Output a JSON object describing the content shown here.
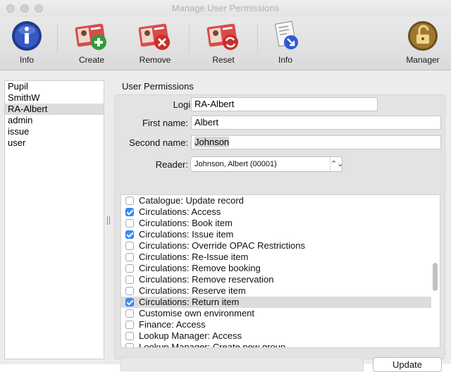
{
  "window": {
    "title": "Manage User Permissions"
  },
  "toolbar": {
    "items": [
      {
        "id": "info",
        "label": "Info",
        "icon": "info-circle-icon"
      },
      {
        "id": "create",
        "label": "Create",
        "icon": "user-card-add-icon"
      },
      {
        "id": "remove",
        "label": "Remove",
        "icon": "user-card-remove-icon"
      },
      {
        "id": "reset",
        "label": "Reset",
        "icon": "user-card-reset-icon"
      },
      {
        "id": "info2",
        "label": "Info",
        "icon": "document-arrow-icon"
      },
      {
        "id": "manager",
        "label": "Manager",
        "icon": "unlocked-padlock-icon"
      }
    ]
  },
  "users": [
    "Pupil",
    "SmithW",
    "RA-Albert",
    "admin",
    "issue",
    "user"
  ],
  "selected_user": "RA-Albert",
  "panel": {
    "title": "User Permissions",
    "login_label": "Login:",
    "login_value": "RA-Albert",
    "first_name_label": "First name:",
    "first_name_value": "Albert",
    "second_name_label": "Second name:",
    "second_name_value": "Johnson",
    "reader_label": "Reader:",
    "reader_value": "Johnson, Albert (00001)"
  },
  "permissions": [
    {
      "label": "Catalogue: Update record",
      "checked": false,
      "selected": false
    },
    {
      "label": "Circulations: Access",
      "checked": true,
      "selected": false
    },
    {
      "label": "Circulations: Book item",
      "checked": false,
      "selected": false
    },
    {
      "label": "Circulations: Issue item",
      "checked": true,
      "selected": false
    },
    {
      "label": "Circulations: Override OPAC Restrictions",
      "checked": false,
      "selected": false
    },
    {
      "label": "Circulations: Re-Issue item",
      "checked": false,
      "selected": false
    },
    {
      "label": "Circulations: Remove booking",
      "checked": false,
      "selected": false
    },
    {
      "label": "Circulations: Remove reservation",
      "checked": false,
      "selected": false
    },
    {
      "label": "Circulations: Reserve item",
      "checked": false,
      "selected": false
    },
    {
      "label": "Circulations: Return item",
      "checked": true,
      "selected": true
    },
    {
      "label": "Customise own environment",
      "checked": false,
      "selected": false
    },
    {
      "label": "Finance: Access",
      "checked": false,
      "selected": false
    },
    {
      "label": "Lookup Manager: Access",
      "checked": false,
      "selected": false
    },
    {
      "label": "Lookup Manager: Create new group",
      "checked": false,
      "selected": false
    }
  ],
  "buttons": {
    "update": "Update"
  },
  "colors": {
    "checkbox_on": "#3b8cf5",
    "selection": "#dcdcdc"
  }
}
